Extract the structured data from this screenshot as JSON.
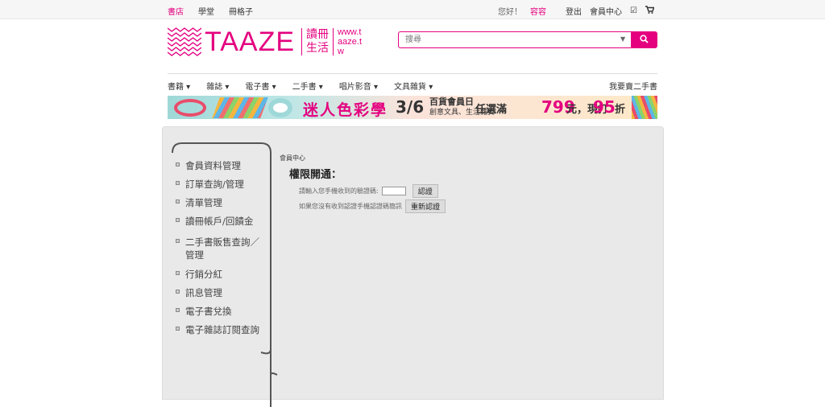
{
  "topbar": {
    "left_links": [
      "書店",
      "學堂",
      "冊格子"
    ],
    "greeting": "您好！",
    "username": "容容",
    "logout": "登出",
    "member_center": "會員中心"
  },
  "header": {
    "brand": "TAAZE",
    "brand_cn": "讀冊生活",
    "brand_url": "www.taaze.tw",
    "search_placeholder": "搜尋"
  },
  "nav": {
    "items": [
      "書籍",
      "雜誌",
      "電子書",
      "二手書",
      "唱片影音",
      "文具雜貨"
    ],
    "sell_link": "我要賣二手書"
  },
  "banner": {
    "headline": "迷人色彩學",
    "date": "3/6",
    "event_line1": "百貨會員日",
    "event_line2": "創意文具、生活雜貨",
    "offer_prefix": "任選滿",
    "offer_amount": "799",
    "offer_unit": "元，現打",
    "discount": "95",
    "discount_unit": "折"
  },
  "sidebar": {
    "items": [
      "會員資料管理",
      "訂單查詢/管理",
      "清單管理",
      "讀冊帳戶/回饋金",
      "二手書販售查詢／管理",
      "行銷分紅",
      "訊息管理",
      "電子書兌換",
      "電子雜誌訂閱查詢"
    ]
  },
  "main": {
    "breadcrumb": "會員中心",
    "title": "權限開通：",
    "verify_prompt": "請輸入您手機收到的驗證碼:",
    "verify_button": "認證",
    "resend_prompt": "如果您沒有收到認證手機認證碼簡訊",
    "resend_button": "重新認證"
  },
  "colors": {
    "accent": "#e4007f"
  }
}
